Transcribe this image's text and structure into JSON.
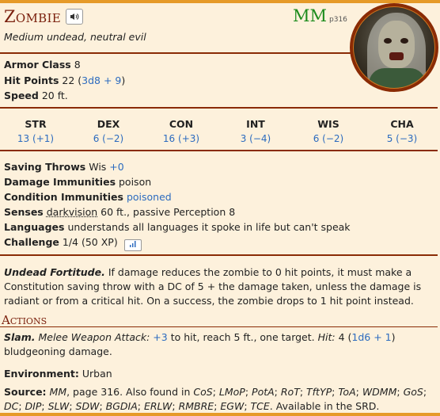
{
  "header": {
    "name": "Zombie",
    "sound_icon": "speaker-icon",
    "source_abbr": "MM",
    "source_page": "p316",
    "meta": "Medium undead, neutral evil"
  },
  "basics": {
    "ac_label": "Armor Class",
    "ac_value": "8",
    "hp_label": "Hit Points",
    "hp_value": "22",
    "hp_formula": "3d8 + 9",
    "speed_label": "Speed",
    "speed_value": "20 ft."
  },
  "abilities": [
    {
      "label": "STR",
      "value": "13 (+1)"
    },
    {
      "label": "DEX",
      "value": "6 (−2)"
    },
    {
      "label": "CON",
      "value": "16 (+3)"
    },
    {
      "label": "INT",
      "value": "3 (−4)"
    },
    {
      "label": "WIS",
      "value": "6 (−2)"
    },
    {
      "label": "CHA",
      "value": "5 (−3)"
    }
  ],
  "details": {
    "saves_label": "Saving Throws",
    "saves_text": "Wis",
    "saves_bonus": "+0",
    "dmg_imm_label": "Damage Immunities",
    "dmg_imm_value": "poison",
    "cond_imm_label": "Condition Immunities",
    "cond_imm_value": "poisoned",
    "senses_label": "Senses",
    "senses_link": "darkvision",
    "senses_rest": "60 ft., passive Perception 8",
    "languages_label": "Languages",
    "languages_value": "understands all languages it spoke in life but can't speak",
    "challenge_label": "Challenge",
    "challenge_value": "1/4 (50 XP)",
    "challenge_icon": "bar-chart-icon"
  },
  "traits": {
    "fortitude_name": "Undead Fortitude.",
    "fortitude_text": "If damage reduces the zombie to 0 hit points, it must make a Constitution saving throw with a DC of 5 + the damage taken, unless the damage is radiant or from a critical hit. On a success, the zombie drops to 1 hit point instead."
  },
  "actions": {
    "heading": "Actions",
    "slam_name": "Slam.",
    "slam_type": "Melee Weapon Attack:",
    "slam_bonus": "+3",
    "slam_mid": "to hit, reach 5 ft., one target.",
    "slam_hit_label": "Hit:",
    "slam_hit_value": "4",
    "slam_dice": "1d6 + 1",
    "slam_end": "bludgeoning damage."
  },
  "environment": {
    "label": "Environment:",
    "value": "Urban"
  },
  "source": {
    "label": "Source:",
    "book": "MM",
    "page": ", page 316. Also found in",
    "others": [
      "CoS",
      "LMoP",
      "PotA",
      "RoT",
      "TftYP",
      "ToA",
      "WDMM",
      "GoS",
      "DC",
      "DIP",
      "SLW",
      "SDW",
      "BGDIA",
      "ERLW",
      "RMBRE",
      "EGW",
      "TCE"
    ],
    "tail": "Available in the SRD."
  }
}
